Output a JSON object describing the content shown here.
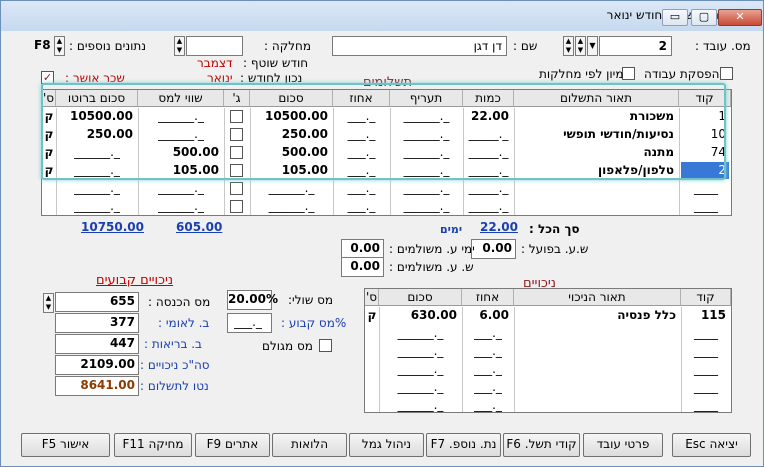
{
  "window": {
    "title": "הכנת השכר לחודש ינואר",
    "min": "▭",
    "max": "▢",
    "close": "✕"
  },
  "header": {
    "employee_label": "מס. עובד :",
    "employee_value": "2",
    "name_label": "שם :",
    "name_value": "דן דגן",
    "dept_label": "מחלקה :",
    "dept_value": "",
    "extra_label": "נתונים נוספים :",
    "extra_key": "F8",
    "shared_month_label": "חודש שוטף :",
    "shared_month_value": "דצמבר",
    "correct_label": "נכון לחודש :",
    "correct_value": "ינואר",
    "stop_work_label": "הפסקת עבודה",
    "sort_label": "מיון לפי מחלקות",
    "approved_label": "שכר אושר :",
    "approved_mark": "✓"
  },
  "payments": {
    "title": "תשלומים",
    "columns": [
      "קוד",
      "תאור התשלום",
      "כמות",
      "תעריף",
      "אחוז",
      "סכום",
      "ג'",
      "שווי למס",
      "סכום ברוטו",
      "ס'"
    ],
    "rows": [
      {
        "code": "1",
        "desc": "משכורת",
        "qty": "22.00",
        "rate": "______._",
        "pct": "___._",
        "sum": "10500.00",
        "tax": "______._",
        "gross": "10500.00",
        "s": "ק"
      },
      {
        "code": "10",
        "desc": "נסיעות/חודשי תופשי",
        "qty": "_____._",
        "rate": "______._",
        "pct": "___._",
        "sum": "250.00",
        "tax": "______._",
        "gross": "250.00",
        "s": "ק"
      },
      {
        "code": "74",
        "desc": "מתנה",
        "qty": "_____._",
        "rate": "______._",
        "pct": "___._",
        "sum": "500.00",
        "tax": "500.00",
        "gross": "______._",
        "s": "ק"
      },
      {
        "code": "2",
        "desc": "טלפון/פלאפון",
        "qty": "_____._",
        "rate": "______._",
        "pct": "___._",
        "sum": "105.00",
        "tax": "105.00",
        "gross": "______._",
        "s": "ק"
      },
      {
        "code": "",
        "desc": "",
        "qty": "_____._",
        "rate": "______._",
        "pct": "___._",
        "sum": "______._",
        "tax": "______._",
        "gross": "______._",
        "s": ""
      },
      {
        "code": "",
        "desc": "",
        "qty": "_____._",
        "rate": "______._",
        "pct": "___._",
        "sum": "______._",
        "tax": "______._",
        "gross": "______._",
        "s": ""
      }
    ],
    "total_label": "סך הכל :",
    "total_days": "22.00",
    "days_label": "ימים",
    "total_tax": "605.00",
    "total_gross": "10750.00",
    "actual_label": "ש.ע. בפועל :",
    "actual_value": "0.00",
    "paid_days_label": "ימי ע. משולמים :",
    "paid_days_value": "0.00",
    "paid_hours_label": "ש. ע. משולמים :",
    "paid_hours_value": "0.00"
  },
  "fixed": {
    "title": "ניכויים קבועים",
    "income_tax_label": "מס הכנסה :",
    "income_tax_value": "655",
    "national_label": "ב. לאומי :",
    "national_value": "377",
    "health_label": "ב. בריאות :",
    "health_value": "447",
    "total_ded_label": "סה\"כ ניכויים :",
    "total_ded_value": "2109.00",
    "net_label": "נטו לתשלום :",
    "net_value": "8641.00",
    "marginal_label": "מס שולי:",
    "marginal_value": "20.00%",
    "fixed_tax_label": "%מס קבוע :",
    "fixed_tax_value": "___._",
    "grossup_label": "מס מגולם"
  },
  "deductions": {
    "title": "ניכויים",
    "columns": [
      "קוד",
      "תאור הניכוי",
      "אחוז",
      "סכום",
      "ס'"
    ],
    "rows": [
      {
        "code": "115",
        "desc": "כלל פנסיה",
        "pct": "6.00",
        "sum": "630.00",
        "s": "ק"
      },
      {
        "code": "",
        "desc": "",
        "pct": "___._",
        "sum": "______._",
        "s": ""
      },
      {
        "code": "",
        "desc": "",
        "pct": "___._",
        "sum": "______._",
        "s": ""
      },
      {
        "code": "",
        "desc": "",
        "pct": "___._",
        "sum": "______._",
        "s": ""
      },
      {
        "code": "",
        "desc": "",
        "pct": "___._",
        "sum": "______._",
        "s": ""
      },
      {
        "code": "",
        "desc": "",
        "pct": "___._",
        "sum": "______._",
        "s": ""
      }
    ]
  },
  "buttons": {
    "exit": "יציאה Esc",
    "worker": "פרטי עובד",
    "codes": "קודי תשל. F6",
    "more": "נת. נוספ. F7",
    "gemel": "ניהול גמל",
    "loans": "הלואות",
    "alerts": "אתרים F9",
    "delete": "מחיקה F11",
    "approve": "אישור F5"
  }
}
